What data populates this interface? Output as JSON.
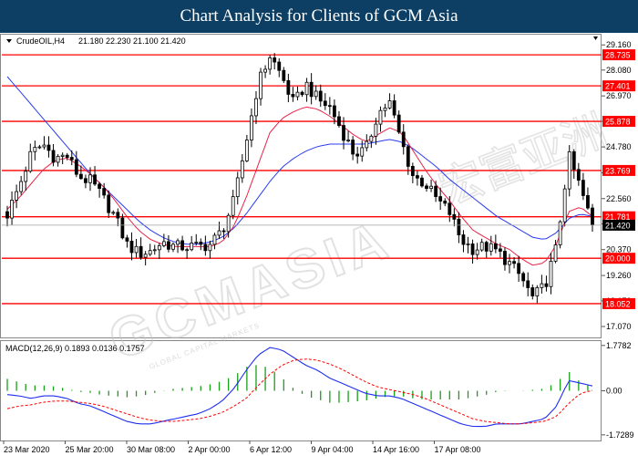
{
  "header": {
    "title": "Chart Analysis for Clients of GCM Asia"
  },
  "watermark": {
    "text": "GCMASIA",
    "chinese": "宏富亚洲",
    "sub": "GLOBAL CAPITAL MARKETS"
  },
  "colors": {
    "level_line": "#ff0000",
    "ma_fast": "#e8244a",
    "ma_slow": "#2b3cf0",
    "macd_line": "#1f2ef0",
    "signal_line": "#ff0000",
    "histogram": "#1a9e1a",
    "title_bg": "#0c3f63"
  },
  "chart_data": [
    {
      "type": "candlestick",
      "symbol_label": "CrudeOIL,H4",
      "ohlc_label": "21.180 22.230 21.100 21.420",
      "current_price": 21.42,
      "current_price_label": "21.420",
      "ylim": [
        16.6,
        29.6
      ],
      "y_ticks": [
        "29.160",
        "28.080",
        "26.970",
        "25.880",
        "24.780",
        "23.670",
        "22.560",
        "21.470",
        "20.370",
        "19.260",
        "18.170",
        "17.070"
      ],
      "y_tick_values": [
        29.16,
        28.08,
        26.97,
        25.88,
        24.78,
        23.67,
        22.56,
        21.47,
        20.37,
        19.26,
        18.17,
        17.07
      ],
      "levels": [
        28.735,
        27.401,
        25.878,
        23.769,
        21.781,
        20.0,
        18.052
      ],
      "level_labels": [
        "28.735",
        "27.401",
        "25.878",
        "23.769",
        "21.781",
        "20.000",
        "18.052"
      ],
      "x_tick_labels": [
        "23 Mar 2020",
        "25 Mar 20:00",
        "30 Mar 08:00",
        "2 Apr 00:00",
        "6 Apr 12:00",
        "9 Apr 04:00",
        "14 Apr 16:00",
        "17 Apr 08:00"
      ],
      "close_path": [
        21.9,
        23.1,
        24.5,
        24.9,
        24.3,
        24.4,
        23.5,
        23.3,
        22.6,
        21.8,
        20.6,
        20.2,
        20.3,
        20.7,
        20.5,
        20.5,
        20.5,
        20.6,
        21.2,
        22.5,
        25.0,
        27.5,
        28.7,
        27.8,
        26.6,
        27.5,
        26.8,
        26.5,
        25.5,
        24.5,
        24.6,
        26.2,
        26.7,
        25.0,
        23.5,
        23.2,
        22.5,
        22.0,
        20.8,
        20.4,
        20.5,
        20.3,
        19.8,
        19.2,
        18.3,
        18.8,
        20.5,
        24.4,
        23.0,
        21.4
      ],
      "ma_fast_path": [
        22.1,
        22.6,
        23.2,
        23.8,
        24.2,
        24.3,
        24.0,
        23.6,
        23.1,
        22.5,
        21.8,
        21.2,
        20.8,
        20.6,
        20.5,
        20.5,
        20.5,
        20.5,
        20.7,
        21.4,
        22.6,
        24.0,
        25.4,
        26.0,
        26.3,
        26.5,
        26.4,
        26.1,
        25.7,
        25.3,
        25.0,
        25.3,
        25.6,
        25.4,
        24.6,
        23.8,
        23.1,
        22.5,
        21.8,
        21.2,
        20.9,
        20.6,
        20.4,
        20.0,
        19.7,
        19.8,
        20.6,
        22.0,
        22.2,
        21.8
      ],
      "ma_slow_path": [
        27.8,
        27.2,
        26.6,
        26.0,
        25.4,
        24.8,
        24.2,
        23.6,
        23.1,
        22.6,
        22.1,
        21.6,
        21.2,
        20.9,
        20.7,
        20.6,
        20.6,
        20.7,
        20.9,
        21.3,
        21.9,
        22.6,
        23.3,
        23.9,
        24.3,
        24.6,
        24.8,
        24.9,
        24.9,
        24.9,
        24.9,
        25.0,
        25.1,
        25.0,
        24.7,
        24.3,
        23.9,
        23.4,
        23.0,
        22.6,
        22.2,
        21.8,
        21.5,
        21.2,
        20.9,
        20.8,
        21.1,
        21.7,
        21.9,
        21.8
      ]
    },
    {
      "type": "line",
      "label": "MACD(12,26,9) 0.1893 0.0136 0.1757",
      "ylim": [
        -1.95,
        1.95
      ],
      "y_ticks": [
        "1.7782",
        "0.00",
        "-1.7289"
      ],
      "y_tick_values": [
        1.7782,
        0.0,
        -1.7289
      ],
      "macd_path": [
        -0.15,
        -0.2,
        -0.3,
        -0.2,
        -0.2,
        -0.3,
        -0.5,
        -0.6,
        -0.8,
        -1.0,
        -1.2,
        -1.3,
        -1.3,
        -1.2,
        -1.1,
        -1.0,
        -0.9,
        -0.7,
        -0.4,
        0.1,
        0.8,
        1.4,
        1.7,
        1.6,
        1.3,
        1.0,
        0.8,
        0.5,
        0.3,
        0.1,
        -0.1,
        -0.2,
        -0.2,
        -0.3,
        -0.5,
        -0.7,
        -0.9,
        -1.1,
        -1.3,
        -1.4,
        -1.4,
        -1.3,
        -1.3,
        -1.3,
        -1.2,
        -1.1,
        -0.6,
        0.4,
        0.3,
        0.19
      ],
      "signal_path": [
        -0.7,
        -0.6,
        -0.55,
        -0.45,
        -0.4,
        -0.4,
        -0.45,
        -0.5,
        -0.6,
        -0.75,
        -0.9,
        -1.05,
        -1.15,
        -1.2,
        -1.2,
        -1.15,
        -1.1,
        -1.0,
        -0.85,
        -0.6,
        -0.3,
        0.2,
        0.65,
        1.0,
        1.2,
        1.25,
        1.2,
        1.05,
        0.85,
        0.6,
        0.35,
        0.15,
        0.05,
        -0.05,
        -0.15,
        -0.3,
        -0.5,
        -0.7,
        -0.9,
        -1.1,
        -1.2,
        -1.25,
        -1.3,
        -1.3,
        -1.25,
        -1.2,
        -1.0,
        -0.5,
        -0.1,
        0.014
      ]
    }
  ]
}
